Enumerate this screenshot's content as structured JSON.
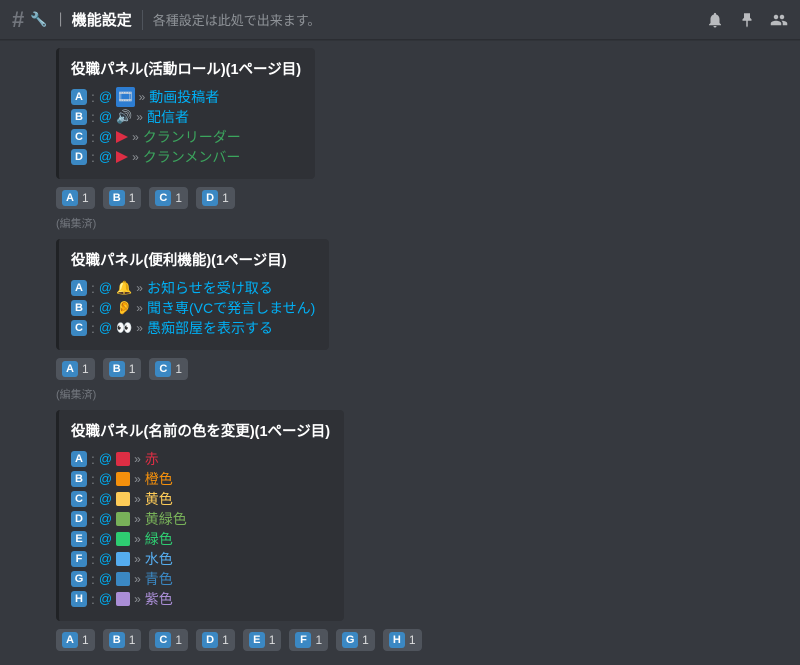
{
  "header": {
    "hash": "#",
    "wrench": "🔧",
    "bar": "｜",
    "channel_name": "機能設定",
    "topic": "各種設定は此処で出来ます。"
  },
  "edited_label": "(編集済)",
  "panels": [
    {
      "title": "役職パネル(活動ロール)(1ページ目)",
      "options": [
        {
          "letter": "A",
          "icon_type": "emoji",
          "icon": "🎞",
          "icon_bg": "#2d7dd2",
          "role": "動画投稿者",
          "color": "#00aff4"
        },
        {
          "letter": "B",
          "icon_type": "emoji",
          "icon": "🔊",
          "icon_bg": "",
          "role": "配信者",
          "color": "#00aff4"
        },
        {
          "letter": "C",
          "icon_type": "flag",
          "icon": "",
          "icon_bg": "",
          "role": "クランリーダー",
          "color": "#3ba55d"
        },
        {
          "letter": "D",
          "icon_type": "flag",
          "icon": "",
          "icon_bg": "",
          "role": "クランメンバー",
          "color": "#3ba55d"
        }
      ],
      "buttons": [
        "A",
        "B",
        "C",
        "D"
      ],
      "show_edited": true
    },
    {
      "title": "役職パネル(便利機能)(1ページ目)",
      "options": [
        {
          "letter": "A",
          "icon_type": "emoji",
          "icon": "🔔",
          "icon_bg": "",
          "role": "お知らせを受け取る",
          "color": "#00aff4"
        },
        {
          "letter": "B",
          "icon_type": "emoji",
          "icon": "👂",
          "icon_bg": "",
          "role": "聞き専(VCで発言しません)",
          "color": "#00aff4"
        },
        {
          "letter": "C",
          "icon_type": "emoji",
          "icon": "👀",
          "icon_bg": "",
          "role": "愚痴部屋を表示する",
          "color": "#00aff4"
        }
      ],
      "buttons": [
        "A",
        "B",
        "C"
      ],
      "show_edited": true
    },
    {
      "title": "役職パネル(名前の色を変更)(1ページ目)",
      "options": [
        {
          "letter": "A",
          "icon_type": "swatch",
          "icon": "",
          "icon_bg": "#dd2e44",
          "role": "赤",
          "color": "#dd2e44"
        },
        {
          "letter": "B",
          "icon_type": "swatch",
          "icon": "",
          "icon_bg": "#f4900c",
          "role": "橙色",
          "color": "#f4900c"
        },
        {
          "letter": "C",
          "icon_type": "swatch",
          "icon": "",
          "icon_bg": "#fdcb58",
          "role": "黄色",
          "color": "#fdcb58"
        },
        {
          "letter": "D",
          "icon_type": "swatch",
          "icon": "",
          "icon_bg": "#78b159",
          "role": "黄緑色",
          "color": "#78b159"
        },
        {
          "letter": "E",
          "icon_type": "swatch",
          "icon": "",
          "icon_bg": "#2ecc71",
          "role": "緑色",
          "color": "#2ecc71"
        },
        {
          "letter": "F",
          "icon_type": "swatch",
          "icon": "",
          "icon_bg": "#55acee",
          "role": "水色",
          "color": "#55acee"
        },
        {
          "letter": "G",
          "icon_type": "swatch",
          "icon": "",
          "icon_bg": "#3b88c3",
          "role": "青色",
          "color": "#3b88c3"
        },
        {
          "letter": "H",
          "icon_type": "swatch",
          "icon": "",
          "icon_bg": "#aa8ed6",
          "role": "紫色",
          "color": "#aa8ed6"
        }
      ],
      "buttons": [
        "A",
        "B",
        "C",
        "D",
        "E",
        "F",
        "G",
        "H"
      ],
      "show_edited": false
    }
  ],
  "button_count": "1",
  "arrows": "»",
  "colon": ":",
  "at": "@"
}
